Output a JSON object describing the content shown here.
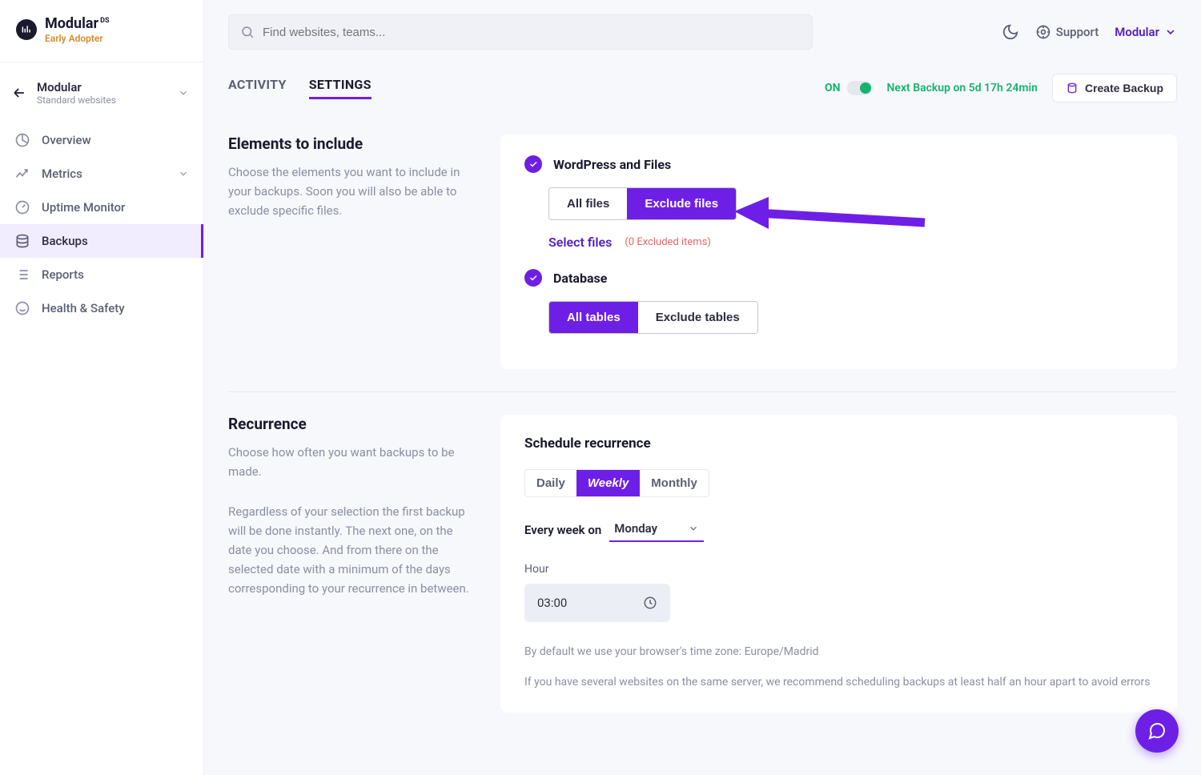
{
  "brand": {
    "name": "Modular",
    "suffix": "DS",
    "tagline": "Early Adopter"
  },
  "site": {
    "name": "Modular",
    "sub": "Standard websites"
  },
  "nav": {
    "overview": "Overview",
    "metrics": "Metrics",
    "uptime": "Uptime Monitor",
    "backups": "Backups",
    "reports": "Reports",
    "health": "Health & Safety"
  },
  "search": {
    "placeholder": "Find websites, teams..."
  },
  "top": {
    "support": "Support",
    "user": "Modular"
  },
  "tabs": {
    "activity": "ACTIVITY",
    "settings": "SETTINGS"
  },
  "status": {
    "on": "ON",
    "next": "Next Backup on 5d 17h 24min",
    "create": "Create Backup"
  },
  "elements": {
    "title": "Elements to include",
    "desc": "Choose the elements you want to include in your backups. Soon you will also be able to exclude specific files.",
    "wp_label": "WordPress and Files",
    "all_files": "All files",
    "exclude_files": "Exclude files",
    "select_files": "Select files",
    "excluded_count": "(0 Excluded items)",
    "db_label": "Database",
    "all_tables": "All tables",
    "exclude_tables": "Exclude tables"
  },
  "recurrence": {
    "title": "Recurrence",
    "desc1": "Choose how often you want backups to be made.",
    "desc2": "Regardless of your selection the first backup will be done instantly. The next one, on the date you choose. And from there on the selected date with a minimum of the days corresponding to your recurrence in between.",
    "schedule_title": "Schedule recurrence",
    "daily": "Daily",
    "weekly": "Weekly",
    "monthly": "Monthly",
    "every_week_on": "Every week on",
    "day": "Monday",
    "hour_label": "Hour",
    "hour_value": "03:00",
    "tz_note": "By default we use your browser's time zone: Europe/Madrid",
    "tz_note2": "If you have several websites on the same server, we recommend scheduling backups at least half an hour apart to avoid errors"
  }
}
